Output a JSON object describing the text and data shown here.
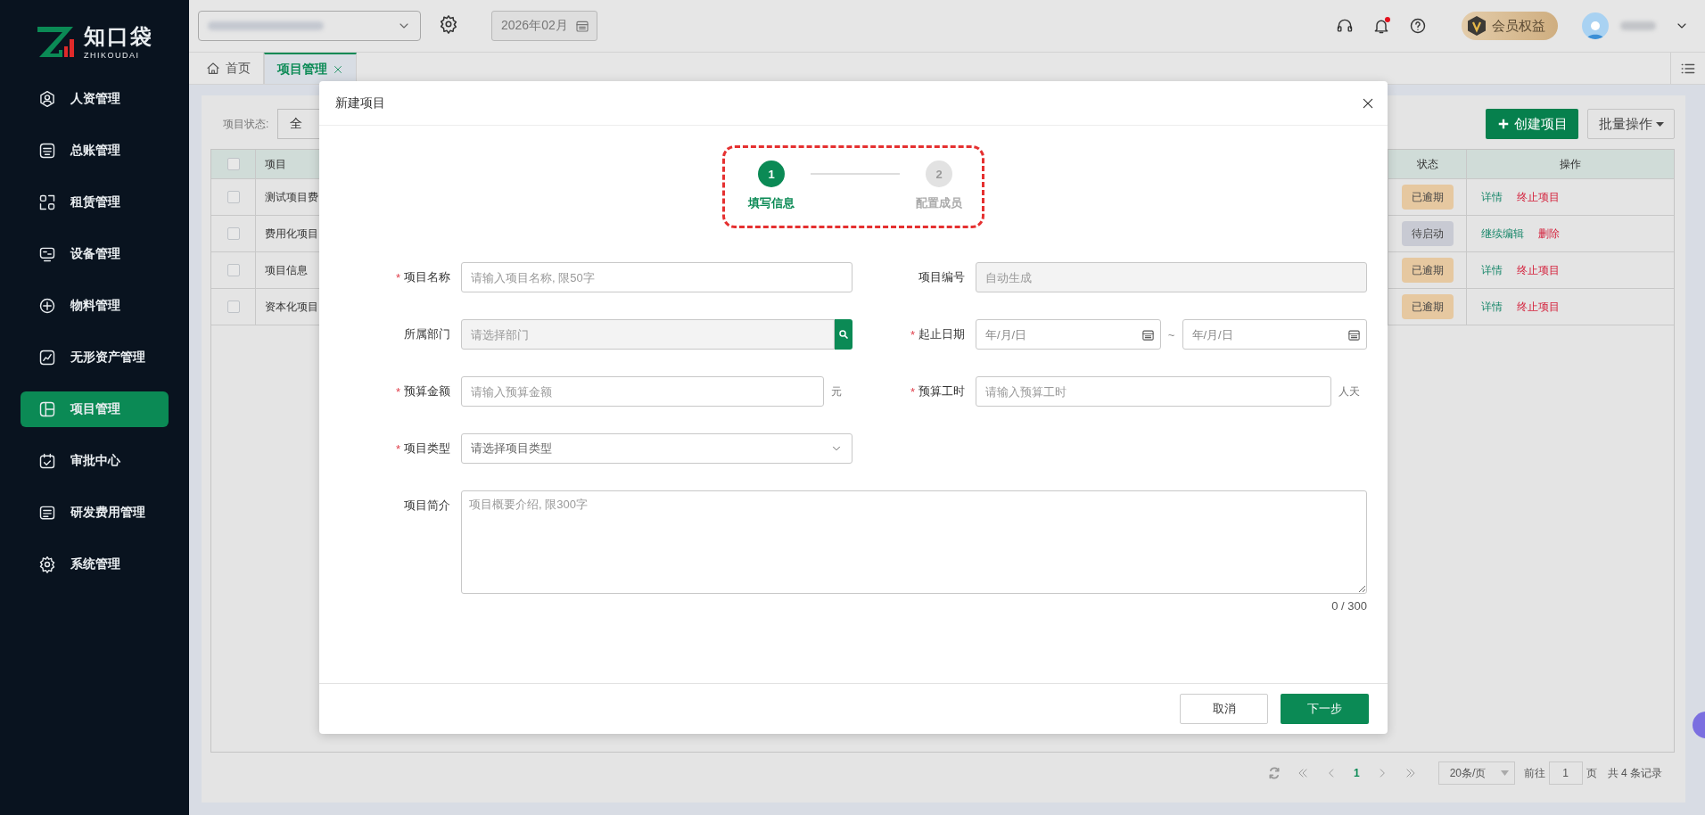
{
  "sidebar": {
    "logo": {
      "name": "知口袋",
      "tagline": "ZHIKOUDAI"
    },
    "items": [
      {
        "label": "人资管理",
        "selected": false
      },
      {
        "label": "总账管理",
        "selected": false
      },
      {
        "label": "租赁管理",
        "selected": false
      },
      {
        "label": "设备管理",
        "selected": false
      },
      {
        "label": "物料管理",
        "selected": false
      },
      {
        "label": "无形资产管理",
        "selected": false
      },
      {
        "label": "项目管理",
        "selected": true
      },
      {
        "label": "审批中心",
        "selected": false
      },
      {
        "label": "研发费用管理",
        "selected": false
      },
      {
        "label": "系统管理",
        "selected": false
      }
    ]
  },
  "topbar": {
    "date": "2026年02月",
    "bell": {
      "unread": true
    },
    "member": "会员权益"
  },
  "tabs": [
    {
      "label": "首页",
      "kind": "home",
      "selected": false,
      "closable": false
    },
    {
      "label": "项目管理",
      "kind": "page",
      "selected": true,
      "closable": true
    }
  ],
  "content": {
    "filter": {
      "label": "项目状态:",
      "value": "全"
    },
    "create_button": "创建项目",
    "batch_button": "批量操作",
    "table": {
      "all_checked": false,
      "columns": [
        "项目",
        "状态",
        "操作"
      ],
      "rows": [
        {
          "checked": false,
          "name": "测试项目费",
          "status": {
            "label": "已逾期",
            "color": "#e6c8a0"
          },
          "actions": [
            {
              "label": "详情",
              "kind": "primary"
            },
            {
              "label": "终止项目",
              "kind": "danger"
            }
          ]
        },
        {
          "checked": false,
          "name": "费用化项目",
          "status": {
            "label": "待启动",
            "color": "#c8cad3"
          },
          "actions": [
            {
              "label": "继续编辑",
              "kind": "primary"
            },
            {
              "label": "删除",
              "kind": "danger"
            }
          ]
        },
        {
          "checked": false,
          "name": "项目信息",
          "status": {
            "label": "已逾期",
            "color": "#e6c8a0"
          },
          "actions": [
            {
              "label": "详情",
              "kind": "primary"
            },
            {
              "label": "终止项目",
              "kind": "danger"
            }
          ]
        },
        {
          "checked": false,
          "name": "资本化项目",
          "status": {
            "label": "已逾期",
            "color": "#e6c8a0"
          },
          "actions": [
            {
              "label": "详情",
              "kind": "primary"
            },
            {
              "label": "终止项目",
              "kind": "danger"
            }
          ]
        }
      ]
    },
    "pagination": {
      "page": "1",
      "page_size": "20条/页",
      "goto_label": "前往",
      "goto_value": "1",
      "page_unit": "页",
      "total": "共 4 条记录"
    }
  },
  "modal": {
    "title": "新建项目",
    "highlight_steps": true,
    "steps": [
      {
        "number": "1",
        "label": "填写信息",
        "selected": true
      },
      {
        "number": "2",
        "label": "配置成员",
        "selected": false
      }
    ],
    "rows": [
      [
        {
          "kind": "text",
          "label": "项目名称",
          "required": true,
          "placeholder": "请输入项目名称, 限50字",
          "disabled": false
        },
        {
          "kind": "text",
          "label": "项目编号",
          "required": false,
          "placeholder": "自动生成",
          "disabled": true
        }
      ],
      [
        {
          "kind": "search",
          "label": "所属部门",
          "required": false,
          "placeholder": "请选择部门",
          "disabled": true
        },
        {
          "kind": "daterange",
          "label": "起止日期",
          "required": true,
          "placeholders": [
            "年/月/日",
            "年/月/日"
          ],
          "separator": "~"
        }
      ],
      [
        {
          "kind": "unit",
          "label": "预算金额",
          "required": true,
          "placeholder": "请输入预算金额",
          "unit": "元"
        },
        {
          "kind": "unit",
          "label": "预算工时",
          "required": true,
          "placeholder": "请输入预算工时",
          "unit": "人天"
        }
      ],
      [
        {
          "kind": "select",
          "label": "项目类型",
          "required": true,
          "placeholder": "请选择项目类型"
        }
      ],
      [
        {
          "kind": "textarea",
          "label": "项目简介",
          "required": false,
          "placeholder": "项目概要介绍, 限300字",
          "counter": "0 / 300"
        }
      ]
    ],
    "required_mark": "*",
    "cancel_button": "取消",
    "next_button": "下一步"
  }
}
